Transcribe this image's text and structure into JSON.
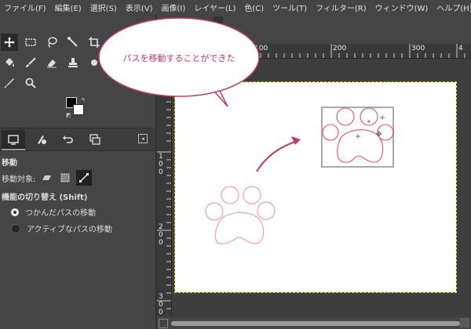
{
  "menu": [
    "ファイル(F)",
    "編集(E)",
    "選択(S)",
    "表示(V)",
    "画像(I)",
    "レイヤー(L)",
    "色(C)",
    "ツール(T)",
    "フィルター(R)",
    "ウィンドウ(W)",
    "ヘルプ(H)"
  ],
  "callout": "パスを移動することができた",
  "tool_options": {
    "title": "移動",
    "target_label": "移動対象:",
    "toggle_label": "機能の切り替え (Shift)",
    "options": [
      {
        "label": "つかんだパスの移動",
        "selected": true
      },
      {
        "label": "アクティブなパスの移動",
        "selected": false
      }
    ]
  },
  "ruler": {
    "top": [
      "100",
      "200",
      "300",
      "4"
    ],
    "left": [
      "1",
      "0",
      "0",
      "2",
      "0",
      "0",
      "3",
      "0",
      "0"
    ]
  },
  "colors": {
    "accent": "#c23a6a",
    "paw": "#f0a0b0",
    "paw_moved": "#e0506a",
    "selection": "#d8d800"
  },
  "icons": {
    "tools": [
      "move-icon",
      "rect-select-icon",
      "lasso-icon",
      "fuzzy-select-icon",
      "crop-icon",
      "bucket-fill-icon",
      "paintbrush-icon",
      "eraser-icon",
      "clone-icon",
      "smudge-icon",
      "color-picker-icon",
      "zoom-icon"
    ],
    "tabs": [
      "tool-options-tab-icon",
      "device-status-tab-icon",
      "undo-history-tab-icon",
      "images-tab-icon"
    ]
  }
}
